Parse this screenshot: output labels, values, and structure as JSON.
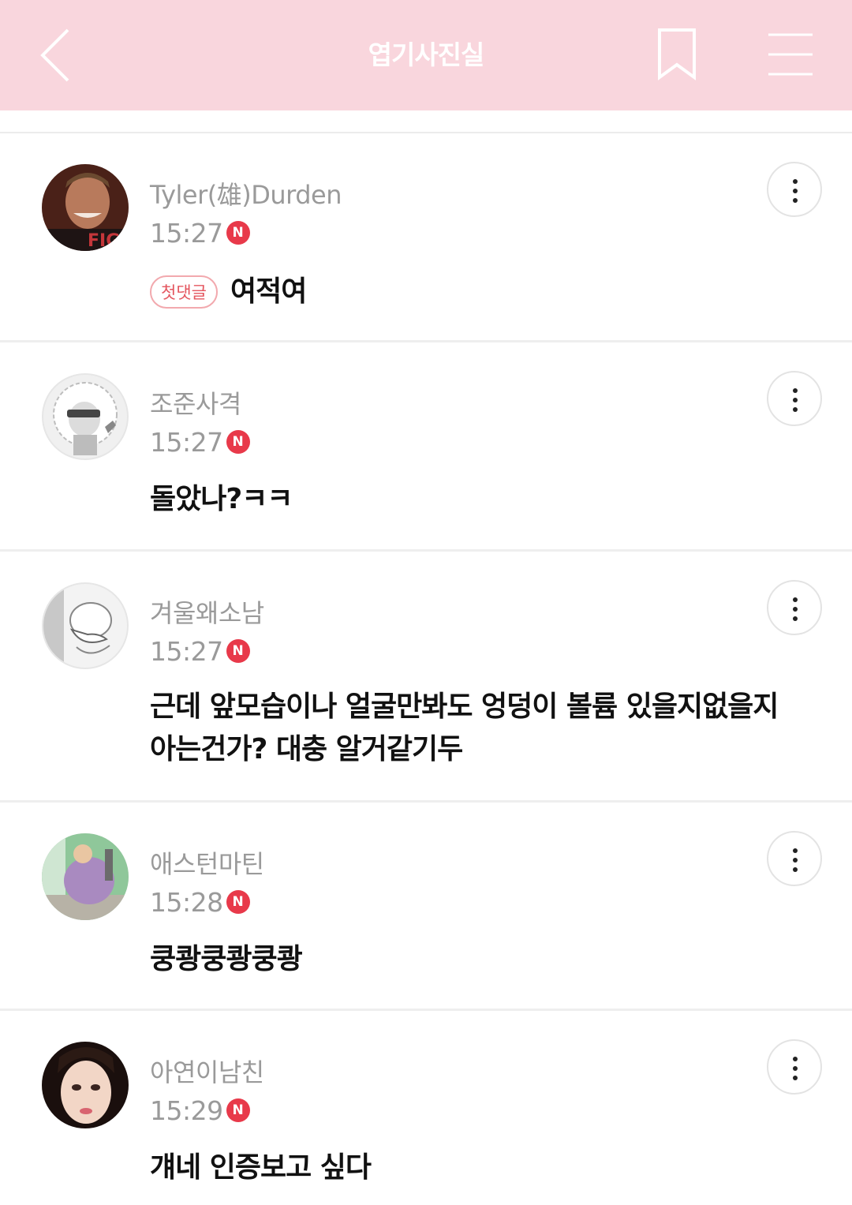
{
  "header": {
    "title": "엽기사진실",
    "bg_color": "#f9d6dd",
    "icons": [
      "back-arrow-icon",
      "bookmark-icon",
      "menu-icon"
    ]
  },
  "comments": [
    {
      "author": "Tyler(雄)Durden",
      "time": "15:27",
      "new_badge": "N",
      "first_badge": "첫댓글",
      "text": "여적여",
      "avatar": "photo-avatar"
    },
    {
      "author": "조준사격",
      "time": "15:27",
      "new_badge": "N",
      "text": "돌았나?ㅋㅋ",
      "avatar": "character-avatar"
    },
    {
      "author": "겨울왜소남",
      "time": "15:27",
      "new_badge": "N",
      "text": "근데 앞모습이나 얼굴만봐도 엉덩이 볼륨 있을지없을지 아는건가? 대충 알거같기두",
      "avatar": "character-avatar"
    },
    {
      "author": "애스턴마틴",
      "time": "15:28",
      "new_badge": "N",
      "text": "쿵쾅쿵쾅쿵쾅",
      "avatar": "photo-avatar"
    },
    {
      "author": "아연이남친",
      "time": "15:29",
      "new_badge": "N",
      "text": "걔네 인증보고 싶다",
      "avatar": "photo-avatar"
    }
  ],
  "colors": {
    "badge_red": "#e8394a",
    "meta_gray": "#9a9a9a",
    "first_badge": "#e4565f"
  }
}
